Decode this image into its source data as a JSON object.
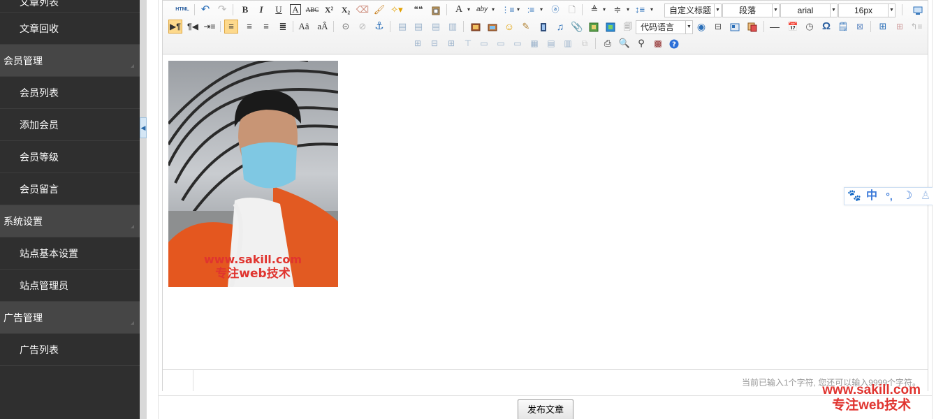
{
  "sidebar": {
    "top_partial": "文章列表",
    "items": [
      {
        "type": "item",
        "label": "文章回收"
      },
      {
        "type": "group",
        "label": "会员管理"
      },
      {
        "type": "item",
        "label": "会员列表"
      },
      {
        "type": "item",
        "label": "添加会员"
      },
      {
        "type": "item",
        "label": "会员等级"
      },
      {
        "type": "item",
        "label": "会员留言"
      },
      {
        "type": "group",
        "label": "系统设置"
      },
      {
        "type": "item",
        "label": "站点基本设置"
      },
      {
        "type": "item",
        "label": "站点管理员"
      },
      {
        "type": "group",
        "label": "广告管理"
      },
      {
        "type": "item",
        "label": "广告列表"
      }
    ]
  },
  "toolbar": {
    "html_label": "HTML",
    "bold": "B",
    "italic": "I",
    "underline": "U",
    "border": "A",
    "strike": "ABC",
    "sup": "X²",
    "sub": "X₂",
    "quote": "❝❝",
    "font_color": "A",
    "highlight": "aby",
    "heading_combo": "自定义标题",
    "paragraph_combo": "段落",
    "font_family_combo": "arial",
    "font_size_combo": "16px",
    "code_combo": "代码语言",
    "omega": "Ω"
  },
  "editor": {
    "image_watermark_line1": "www.sakill.com",
    "image_watermark_line2": "专注web技术",
    "status_text": "当前已输入1个字符, 您还可以输入9999个字符。"
  },
  "publish_button": "发布文章",
  "page_watermark": {
    "line1": "www.sakill.com",
    "line2": "专注web技术"
  },
  "ime": {
    "chinese": "中",
    "punct": "°,"
  },
  "colors": {
    "sidebar_bg": "#2f2f2f",
    "sidebar_group_bg": "#464646",
    "active_button": "#fdd98c",
    "watermark": "#e0342f",
    "ime_blue": "#3b7ad9"
  }
}
